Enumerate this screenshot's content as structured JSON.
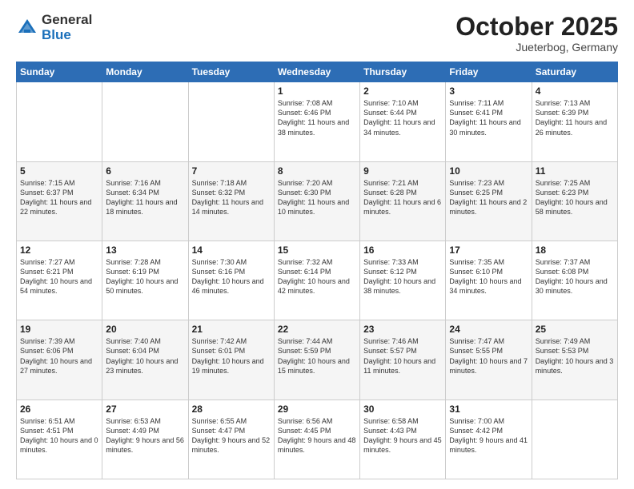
{
  "header": {
    "logo_general": "General",
    "logo_blue": "Blue",
    "month_title": "October 2025",
    "location": "Jueterbog, Germany"
  },
  "days_of_week": [
    "Sunday",
    "Monday",
    "Tuesday",
    "Wednesday",
    "Thursday",
    "Friday",
    "Saturday"
  ],
  "weeks": [
    [
      {
        "day": "",
        "info": ""
      },
      {
        "day": "",
        "info": ""
      },
      {
        "day": "",
        "info": ""
      },
      {
        "day": "1",
        "info": "Sunrise: 7:08 AM\nSunset: 6:46 PM\nDaylight: 11 hours\nand 38 minutes."
      },
      {
        "day": "2",
        "info": "Sunrise: 7:10 AM\nSunset: 6:44 PM\nDaylight: 11 hours\nand 34 minutes."
      },
      {
        "day": "3",
        "info": "Sunrise: 7:11 AM\nSunset: 6:41 PM\nDaylight: 11 hours\nand 30 minutes."
      },
      {
        "day": "4",
        "info": "Sunrise: 7:13 AM\nSunset: 6:39 PM\nDaylight: 11 hours\nand 26 minutes."
      }
    ],
    [
      {
        "day": "5",
        "info": "Sunrise: 7:15 AM\nSunset: 6:37 PM\nDaylight: 11 hours\nand 22 minutes."
      },
      {
        "day": "6",
        "info": "Sunrise: 7:16 AM\nSunset: 6:34 PM\nDaylight: 11 hours\nand 18 minutes."
      },
      {
        "day": "7",
        "info": "Sunrise: 7:18 AM\nSunset: 6:32 PM\nDaylight: 11 hours\nand 14 minutes."
      },
      {
        "day": "8",
        "info": "Sunrise: 7:20 AM\nSunset: 6:30 PM\nDaylight: 11 hours\nand 10 minutes."
      },
      {
        "day": "9",
        "info": "Sunrise: 7:21 AM\nSunset: 6:28 PM\nDaylight: 11 hours\nand 6 minutes."
      },
      {
        "day": "10",
        "info": "Sunrise: 7:23 AM\nSunset: 6:25 PM\nDaylight: 11 hours\nand 2 minutes."
      },
      {
        "day": "11",
        "info": "Sunrise: 7:25 AM\nSunset: 6:23 PM\nDaylight: 10 hours\nand 58 minutes."
      }
    ],
    [
      {
        "day": "12",
        "info": "Sunrise: 7:27 AM\nSunset: 6:21 PM\nDaylight: 10 hours\nand 54 minutes."
      },
      {
        "day": "13",
        "info": "Sunrise: 7:28 AM\nSunset: 6:19 PM\nDaylight: 10 hours\nand 50 minutes."
      },
      {
        "day": "14",
        "info": "Sunrise: 7:30 AM\nSunset: 6:16 PM\nDaylight: 10 hours\nand 46 minutes."
      },
      {
        "day": "15",
        "info": "Sunrise: 7:32 AM\nSunset: 6:14 PM\nDaylight: 10 hours\nand 42 minutes."
      },
      {
        "day": "16",
        "info": "Sunrise: 7:33 AM\nSunset: 6:12 PM\nDaylight: 10 hours\nand 38 minutes."
      },
      {
        "day": "17",
        "info": "Sunrise: 7:35 AM\nSunset: 6:10 PM\nDaylight: 10 hours\nand 34 minutes."
      },
      {
        "day": "18",
        "info": "Sunrise: 7:37 AM\nSunset: 6:08 PM\nDaylight: 10 hours\nand 30 minutes."
      }
    ],
    [
      {
        "day": "19",
        "info": "Sunrise: 7:39 AM\nSunset: 6:06 PM\nDaylight: 10 hours\nand 27 minutes."
      },
      {
        "day": "20",
        "info": "Sunrise: 7:40 AM\nSunset: 6:04 PM\nDaylight: 10 hours\nand 23 minutes."
      },
      {
        "day": "21",
        "info": "Sunrise: 7:42 AM\nSunset: 6:01 PM\nDaylight: 10 hours\nand 19 minutes."
      },
      {
        "day": "22",
        "info": "Sunrise: 7:44 AM\nSunset: 5:59 PM\nDaylight: 10 hours\nand 15 minutes."
      },
      {
        "day": "23",
        "info": "Sunrise: 7:46 AM\nSunset: 5:57 PM\nDaylight: 10 hours\nand 11 minutes."
      },
      {
        "day": "24",
        "info": "Sunrise: 7:47 AM\nSunset: 5:55 PM\nDaylight: 10 hours\nand 7 minutes."
      },
      {
        "day": "25",
        "info": "Sunrise: 7:49 AM\nSunset: 5:53 PM\nDaylight: 10 hours\nand 3 minutes."
      }
    ],
    [
      {
        "day": "26",
        "info": "Sunrise: 6:51 AM\nSunset: 4:51 PM\nDaylight: 10 hours\nand 0 minutes."
      },
      {
        "day": "27",
        "info": "Sunrise: 6:53 AM\nSunset: 4:49 PM\nDaylight: 9 hours\nand 56 minutes."
      },
      {
        "day": "28",
        "info": "Sunrise: 6:55 AM\nSunset: 4:47 PM\nDaylight: 9 hours\nand 52 minutes."
      },
      {
        "day": "29",
        "info": "Sunrise: 6:56 AM\nSunset: 4:45 PM\nDaylight: 9 hours\nand 48 minutes."
      },
      {
        "day": "30",
        "info": "Sunrise: 6:58 AM\nSunset: 4:43 PM\nDaylight: 9 hours\nand 45 minutes."
      },
      {
        "day": "31",
        "info": "Sunrise: 7:00 AM\nSunset: 4:42 PM\nDaylight: 9 hours\nand 41 minutes."
      },
      {
        "day": "",
        "info": ""
      }
    ]
  ]
}
